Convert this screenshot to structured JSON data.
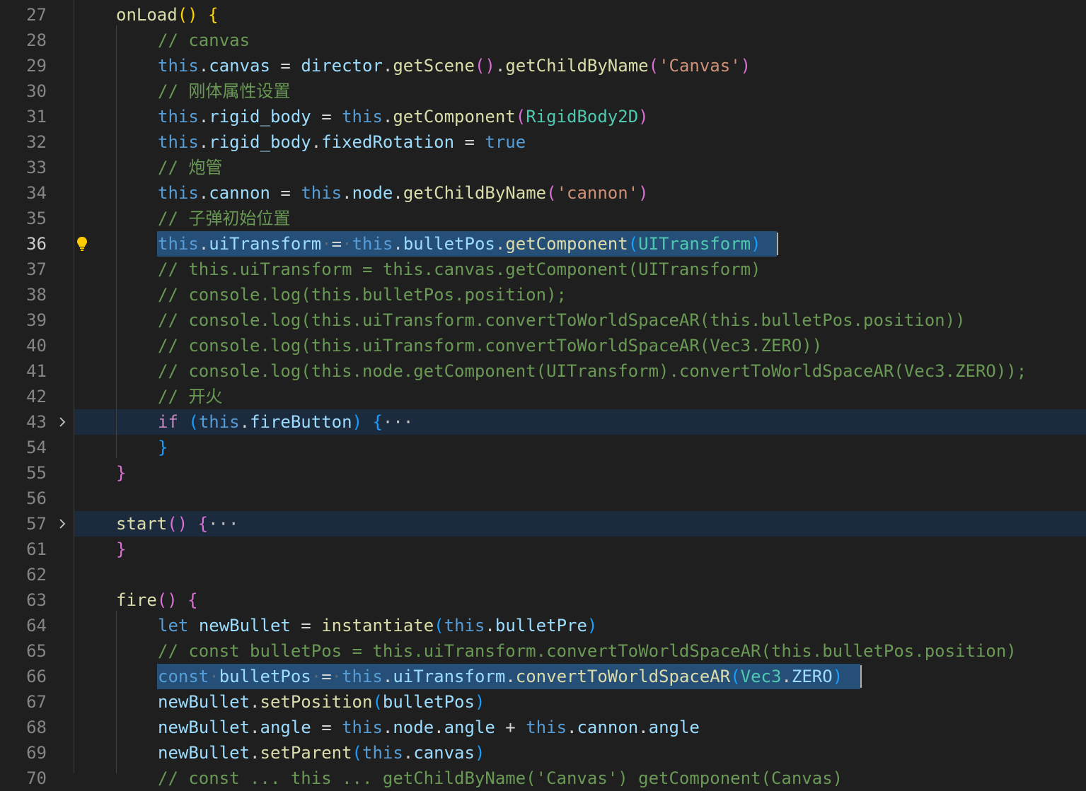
{
  "editor": {
    "language": "typescript",
    "active_line": "36"
  },
  "lines": [
    {
      "n": "27",
      "text": "onLoad() {"
    },
    {
      "n": "28",
      "text": "// canvas"
    },
    {
      "n": "29",
      "text": "this.canvas = director.getScene().getChildByName('Canvas')"
    },
    {
      "n": "30",
      "text": "// 刚体属性设置"
    },
    {
      "n": "31",
      "text": "this.rigid_body = this.getComponent(RigidBody2D)"
    },
    {
      "n": "32",
      "text": "this.rigid_body.fixedRotation = true"
    },
    {
      "n": "33",
      "text": "// 炮管"
    },
    {
      "n": "34",
      "text": "this.cannon = this.node.getChildByName('cannon')"
    },
    {
      "n": "35",
      "text": "// 子弹初始位置"
    },
    {
      "n": "36",
      "text": "this.uiTransform = this.bulletPos.getComponent(UITransform)"
    },
    {
      "n": "37",
      "text": "// this.uiTransform = this.canvas.getComponent(UITransform)"
    },
    {
      "n": "38",
      "text": "// console.log(this.bulletPos.position);"
    },
    {
      "n": "39",
      "text": "// console.log(this.uiTransform.convertToWorldSpaceAR(this.bulletPos.position))"
    },
    {
      "n": "40",
      "text": "// console.log(this.uiTransform.convertToWorldSpaceAR(Vec3.ZERO))"
    },
    {
      "n": "41",
      "text": "// console.log(this.node.getComponent(UITransform).convertToWorldSpaceAR(Vec3.ZERO));"
    },
    {
      "n": "42",
      "text": "// 开火"
    },
    {
      "n": "43",
      "text": "if (this.fireButton) {…"
    },
    {
      "n": "54",
      "text": "}"
    },
    {
      "n": "55",
      "text": "}"
    },
    {
      "n": "56",
      "text": ""
    },
    {
      "n": "57",
      "text": "start() {…"
    },
    {
      "n": "61",
      "text": "}"
    },
    {
      "n": "62",
      "text": ""
    },
    {
      "n": "63",
      "text": "fire() {"
    },
    {
      "n": "64",
      "text": "let newBullet = instantiate(this.bulletPre)"
    },
    {
      "n": "65",
      "text": "// const bulletPos = this.uiTransform.convertToWorldSpaceAR(this.bulletPos.position)"
    },
    {
      "n": "66",
      "text": "const bulletPos = this.uiTransform.convertToWorldSpaceAR(Vec3.ZERO)"
    },
    {
      "n": "67",
      "text": "newBullet.setPosition(bulletPos)"
    },
    {
      "n": "68",
      "text": "newBullet.angle = this.node.angle + this.cannon.angle"
    },
    {
      "n": "69",
      "text": "newBullet.setParent(this.canvas)"
    },
    {
      "n": "70",
      "text": "// const ... this ... getChildByName('Canvas') getComponent(Canvas)"
    }
  ],
  "colors": {
    "background": "#1f1f1f",
    "selection": "#264f78",
    "folded_line_bg": "#1c2a3d",
    "keyword": "#569cd6",
    "function": "#dcdcaa",
    "variable": "#9cdcfe",
    "class": "#4ec9b0",
    "string": "#ce9178",
    "comment": "#6a9955"
  },
  "icons": {
    "fold": "chevron-right-icon",
    "lightbulb": "lightbulb-icon"
  }
}
